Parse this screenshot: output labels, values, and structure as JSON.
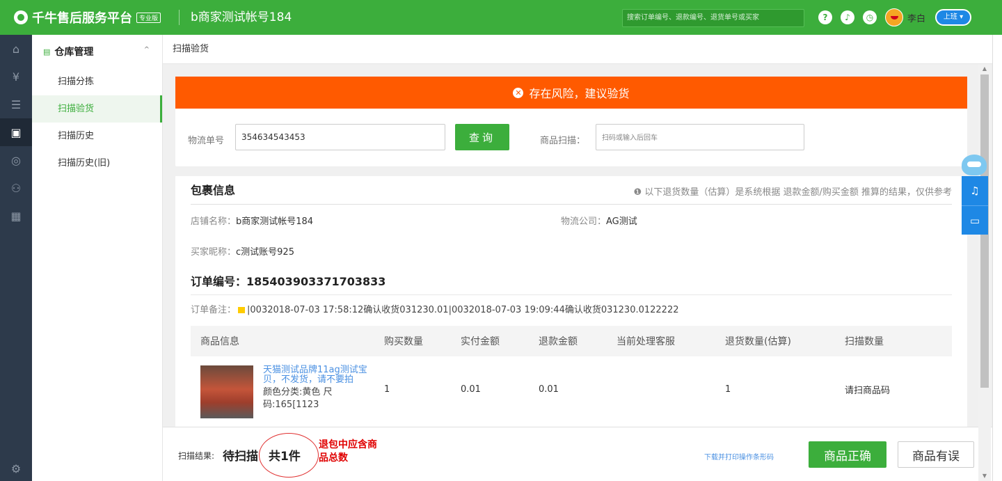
{
  "header": {
    "logo_text": "千牛售后服务平台",
    "pro_badge": "专业版",
    "account_name": "b商家测试帐号184",
    "search_placeholder": "搜索订单编号、退款编号、退货单号或买家",
    "username": "李白",
    "shift_label": "上班"
  },
  "sidebar": {
    "section_title": "仓库管理",
    "items": [
      {
        "label": "扫描分拣"
      },
      {
        "label": "扫描验货"
      },
      {
        "label": "扫描历史"
      },
      {
        "label": "扫描历史(旧)"
      }
    ]
  },
  "breadcrumb": "扫描验货",
  "risk_banner": "存在风险，建议验货",
  "query": {
    "logistics_label": "物流单号",
    "logistics_value": "354634543453",
    "query_button": "查询",
    "scan_label": "商品扫描：",
    "scan_placeholder": "扫码或输入后回车"
  },
  "package": {
    "title": "包裹信息",
    "note": "以下退货数量（估算）是系统根据 退款金额/购买金额 推算的结果，仅供参考",
    "shop_label": "店铺名称：",
    "shop_value": "b商家测试帐号184",
    "logistics_company_label": "物流公司：",
    "logistics_company_value": "AG测试",
    "buyer_label": "买家昵称：",
    "buyer_value": "c测试账号925",
    "order_label": "订单编号：",
    "order_value": "185403903371703833",
    "remark_label": "订单备注：",
    "remark_value": "|0032018-07-03 17:58:12确认收货031230.01|0032018-07-03 19:09:44确认收货031230.0122222"
  },
  "table": {
    "headers": [
      "商品信息",
      "购买数量",
      "实付金额",
      "退款金额",
      "当前处理客服",
      "退货数量(估算)",
      "扫描数量"
    ],
    "rows": [
      {
        "title": "天猫测试品牌11ag测试宝贝，不发货，请不要拍",
        "spec": "颜色分类:黄色 尺码:165[1123",
        "qty": "1",
        "paid": "0.01",
        "refund": "0.01",
        "agent": "",
        "return_qty": "1",
        "scan_hint": "请扫商品码"
      }
    ]
  },
  "footer": {
    "scan_result_label": "扫描结果:",
    "pending": "待扫描",
    "total": "共1件",
    "annotation": "退包中应含商品总数",
    "print_link": "下载并打印操作条形码",
    "ok_button": "商品正确",
    "error_button": "商品有误"
  },
  "colors": {
    "brand_green": "#3cae3c",
    "risk_orange": "#ff5a00",
    "link_blue": "#4a90e2",
    "float_blue": "#1e88e5"
  }
}
